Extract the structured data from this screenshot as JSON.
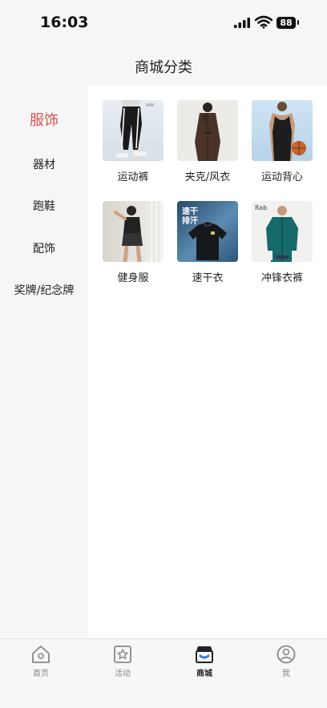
{
  "status": {
    "time": "16:03",
    "battery": "88"
  },
  "header": {
    "title": "商城分类"
  },
  "sidebar": {
    "items": [
      {
        "label": "服饰",
        "active": true
      },
      {
        "label": "器材"
      },
      {
        "label": "跑鞋"
      },
      {
        "label": "配饰"
      },
      {
        "label": "奖牌/纪念牌"
      }
    ]
  },
  "products": [
    {
      "label": "运动裤",
      "icon": "track-pants-photo"
    },
    {
      "label": "夹克/风衣",
      "icon": "trench-coat-photo"
    },
    {
      "label": "运动背心",
      "icon": "tank-top-photo"
    },
    {
      "label": "健身服",
      "icon": "fitness-wear-photo"
    },
    {
      "label": "速干衣",
      "icon": "quick-dry-shirt-photo",
      "thumb_text": "速干\n排汗"
    },
    {
      "label": "冲锋衣裤",
      "icon": "outdoor-jacket-photo",
      "thumb_text": "Rab"
    }
  ],
  "tabbar": {
    "items": [
      {
        "label": "首页",
        "icon": "home-icon"
      },
      {
        "label": "活动",
        "icon": "star-icon"
      },
      {
        "label": "商城",
        "icon": "shop-icon",
        "active": true
      },
      {
        "label": "我",
        "icon": "user-icon"
      }
    ]
  },
  "colors": {
    "accent": "#d9534f",
    "text": "#222222",
    "muted": "#888888"
  }
}
